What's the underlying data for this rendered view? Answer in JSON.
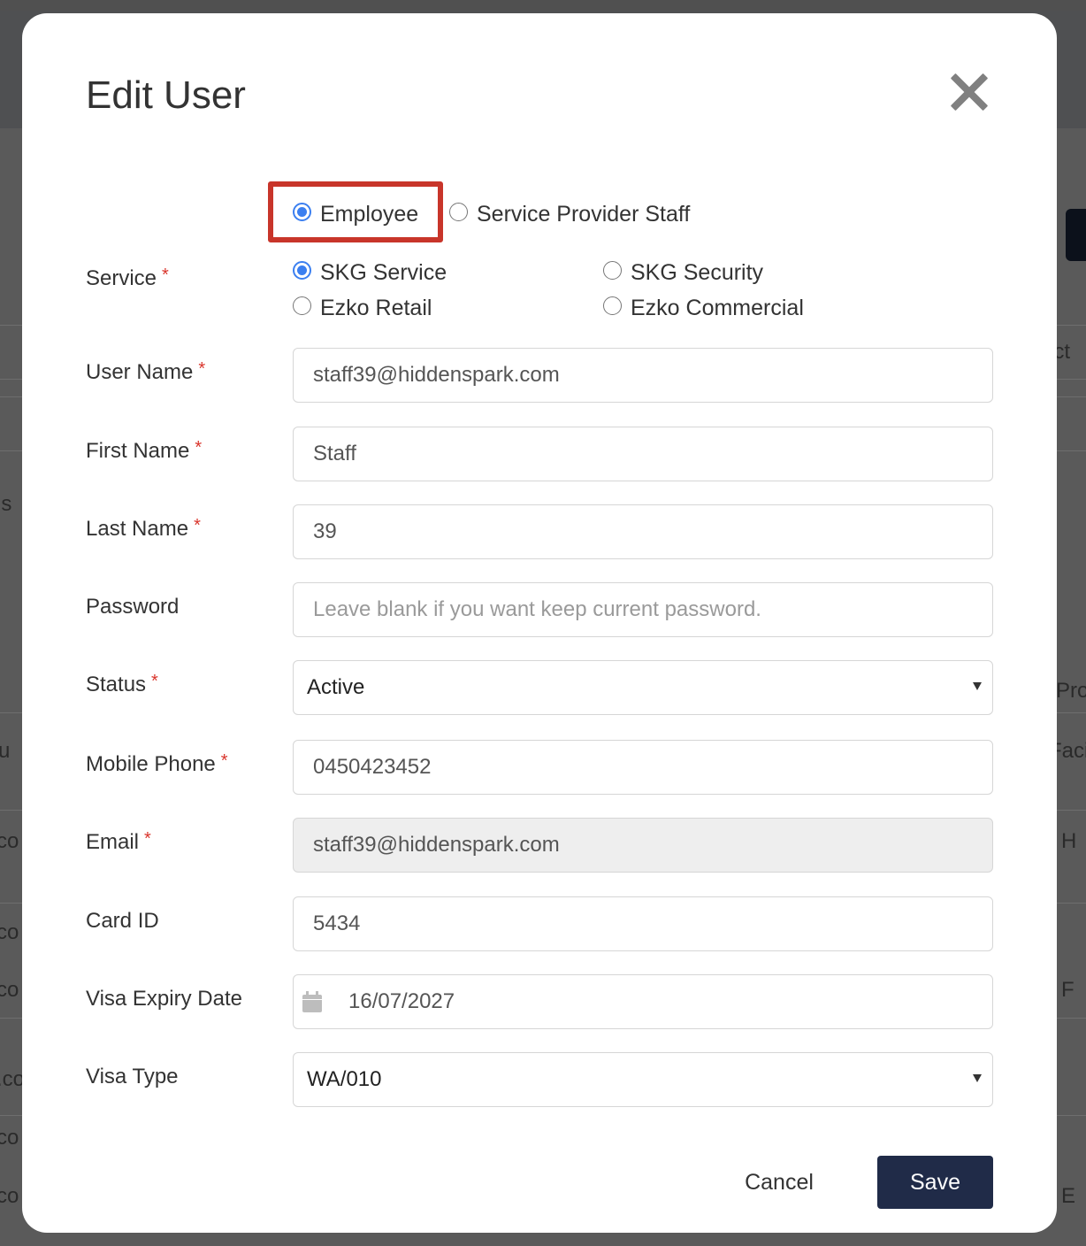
{
  "background": {
    "fragments": [
      "ls",
      "u",
      "co",
      "co",
      "co",
      ".co",
      "co",
      "co",
      "ect",
      "Pro",
      "Faci",
      "H",
      "F",
      "E"
    ]
  },
  "modal": {
    "title": "Edit User",
    "close_icon": "close-icon"
  },
  "user_type": {
    "options": [
      {
        "label": "Employee",
        "checked": true
      },
      {
        "label": "Service Provider Staff",
        "checked": false
      }
    ]
  },
  "service": {
    "label": "Service",
    "required": "*",
    "options": [
      {
        "label": "SKG Service",
        "checked": true
      },
      {
        "label": "SKG Security",
        "checked": false
      },
      {
        "label": "Ezko Retail",
        "checked": false
      },
      {
        "label": "Ezko Commercial",
        "checked": false
      }
    ]
  },
  "form": {
    "user_name": {
      "label": "User Name",
      "required": "*",
      "value": "staff39@hiddenspark.com"
    },
    "first_name": {
      "label": "First Name",
      "required": "*",
      "value": "Staff"
    },
    "last_name": {
      "label": "Last Name",
      "required": "*",
      "value": "39"
    },
    "password": {
      "label": "Password",
      "value": "",
      "placeholder": "Leave blank if you want keep current password."
    },
    "status": {
      "label": "Status",
      "required": "*",
      "value": "Active"
    },
    "mobile_phone": {
      "label": "Mobile Phone",
      "required": "*",
      "value": "0450423452"
    },
    "email": {
      "label": "Email",
      "required": "*",
      "value": "staff39@hiddenspark.com",
      "disabled": true
    },
    "card_id": {
      "label": "Card ID",
      "value": "5434"
    },
    "visa_expiry_date": {
      "label": "Visa Expiry Date",
      "value": "16/07/2027",
      "icon": "calendar-icon"
    },
    "visa_type": {
      "label": "Visa Type",
      "value": "WA/010"
    }
  },
  "actions": {
    "cancel_label": "Cancel",
    "save_label": "Save"
  },
  "colors": {
    "primary_button": "#202b48",
    "radio_accent": "#3b7ff0",
    "required_asterisk": "#d9342b",
    "highlight_box": "#c8352a",
    "overlay": "#5a5a5a"
  }
}
